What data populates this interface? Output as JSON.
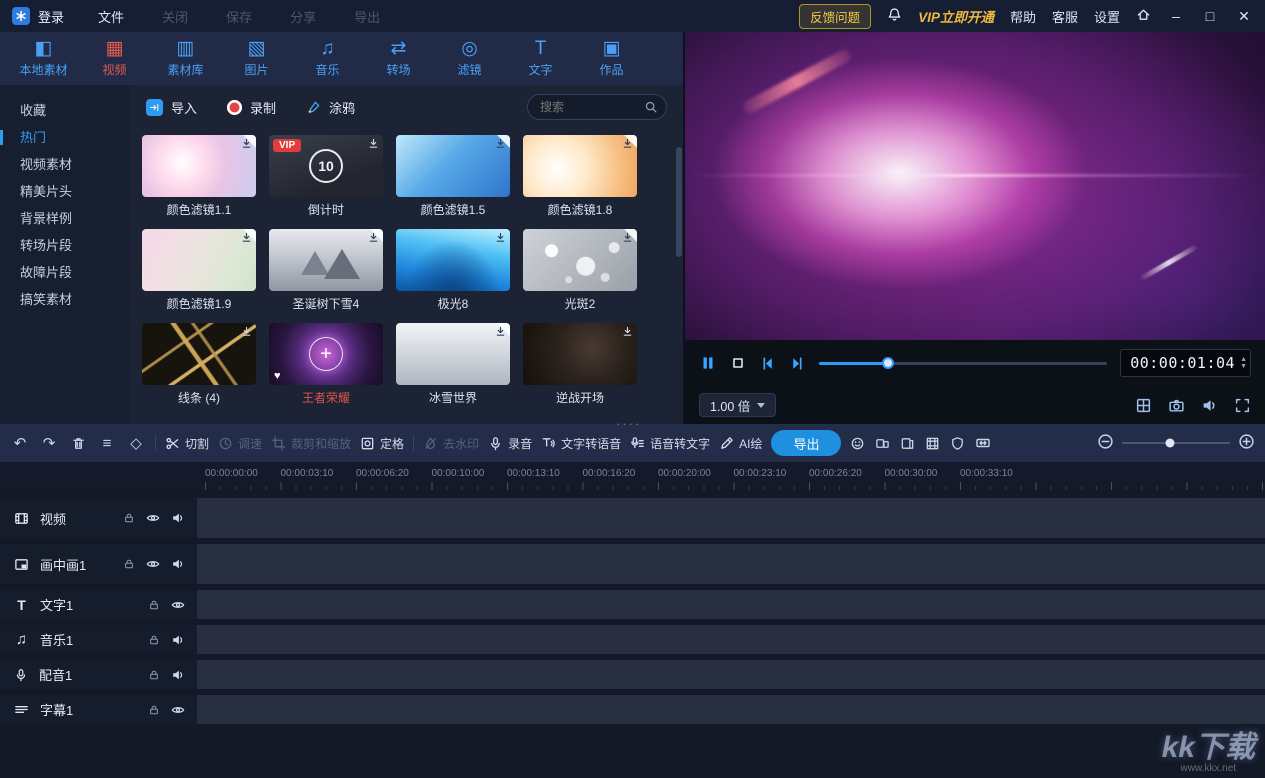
{
  "titlebar": {
    "login": "登录",
    "menus": [
      {
        "label": "文件",
        "enabled": true
      },
      {
        "label": "关闭",
        "enabled": false
      },
      {
        "label": "保存",
        "enabled": false
      },
      {
        "label": "分享",
        "enabled": false
      },
      {
        "label": "导出",
        "enabled": false
      }
    ],
    "feedback": "反馈问题",
    "vip": "VIP立即开通",
    "help": "帮助",
    "support": "客服",
    "settings": "设置"
  },
  "tabs": [
    {
      "label": "本地素材"
    },
    {
      "label": "视频",
      "active": true
    },
    {
      "label": "素材库"
    },
    {
      "label": "图片"
    },
    {
      "label": "音乐"
    },
    {
      "label": "转场"
    },
    {
      "label": "滤镜"
    },
    {
      "label": "文字"
    },
    {
      "label": "作品"
    }
  ],
  "sidebar": {
    "items": [
      {
        "label": "收藏"
      },
      {
        "label": "热门",
        "active": true
      },
      {
        "label": "视频素材"
      },
      {
        "label": "精美片头"
      },
      {
        "label": "背景样例"
      },
      {
        "label": "转场片段"
      },
      {
        "label": "故障片段"
      },
      {
        "label": "搞笑素材"
      }
    ]
  },
  "library": {
    "import_label": "导入",
    "record_label": "录制",
    "doodle_label": "涂鸦",
    "search_placeholder": "搜索",
    "vip_badge": "VIP",
    "items": [
      {
        "title": "颜色滤镜1.1"
      },
      {
        "title": "倒计时",
        "overlay": "10"
      },
      {
        "title": "颜色滤镜1.5"
      },
      {
        "title": "颜色滤镜1.8"
      },
      {
        "title": "颜色滤镜1.9"
      },
      {
        "title": "圣诞树下雪4"
      },
      {
        "title": "极光8"
      },
      {
        "title": "光斑2"
      },
      {
        "title": "线条 (4)"
      },
      {
        "title": "王者荣耀"
      },
      {
        "title": "冰雪世界"
      },
      {
        "title": "逆战开场"
      }
    ]
  },
  "preview": {
    "timecode": "00:00:01:04",
    "speed": "1.00 倍"
  },
  "toolbar": {
    "cut": "切割",
    "speed": "调速",
    "crop": "裁剪和缩放",
    "freeze": "定格",
    "remove_watermark": "去水印",
    "record": "录音",
    "tts": "文字转语音",
    "stt": "语音转文字",
    "ai": "AI绘",
    "export": "导出"
  },
  "timeline": {
    "ruler": [
      "00:00:00:00",
      "00:00:03:10",
      "00:00:06:20",
      "00:00:10:00",
      "00:00:13:10",
      "00:00:16:20",
      "00:00:20:00",
      "00:00:23:10",
      "00:00:26:20",
      "00:00:30:00",
      "00:00:33:10"
    ]
  },
  "tracks": [
    {
      "name": "视频"
    },
    {
      "name": "画中画1"
    },
    {
      "name": "文字1"
    },
    {
      "name": "音乐1"
    },
    {
      "name": "配音1"
    },
    {
      "name": "字幕1"
    }
  ],
  "watermark": {
    "title": "kk下载",
    "url": "www.kkx.net"
  },
  "colors": {
    "accent_blue": "#2f9bf5",
    "accent_red": "#e25a52",
    "vip_gold": "#f0b840",
    "export_blue": "#1f8fe0"
  }
}
